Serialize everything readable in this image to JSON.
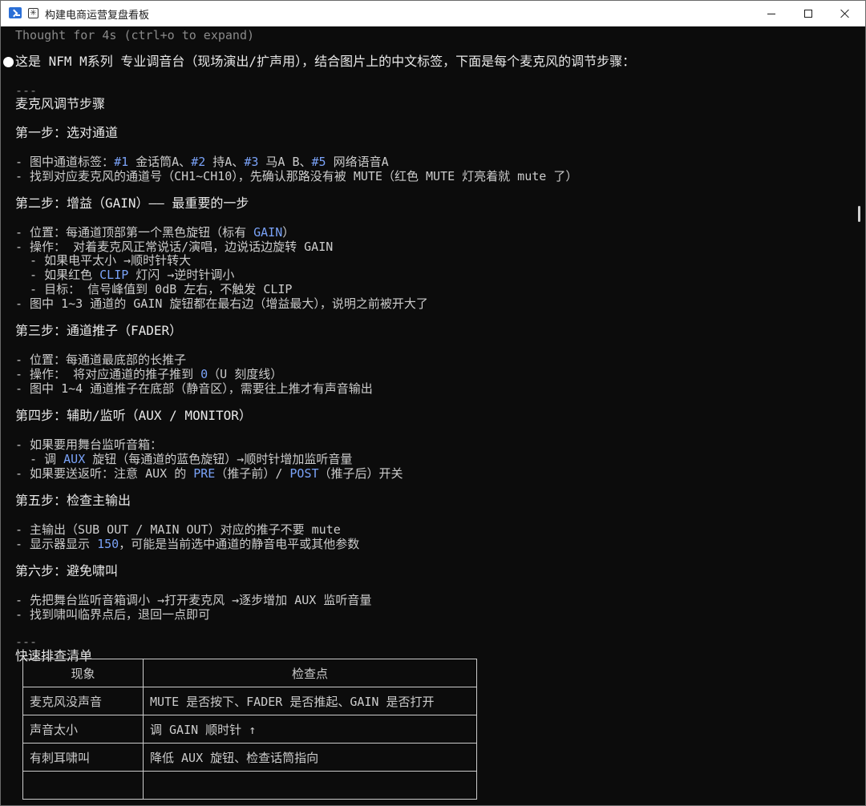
{
  "window": {
    "title": "构建电商运营复盘看板"
  },
  "terminal": {
    "thought": "Thought for 4s (ctrl+o to expand)",
    "intro": "这是 NFM M系列 专业调音台（现场演出/扩声用），结合图片上的中文标签，下面是每个麦克风的调节步骤：",
    "rule1": "---",
    "section_title": "麦克风调节步骤",
    "step1_title": "第一步：选对通道",
    "step1_l1_a": "- 图中通道标签：",
    "step1_l1_h1": "#1",
    "step1_l1_b": " 金话筒A、",
    "step1_l1_h2": "#2",
    "step1_l1_c": " 持A、",
    "step1_l1_h3": "#3",
    "step1_l1_d": " 马A B、",
    "step1_l1_h4": "#5",
    "step1_l1_e": " 网络语音A",
    "step1_l2": "- 找到对应麦克风的通道号（CH1~CH10），先确认那路没有被 MUTE（红色 MUTE 灯亮着就 mute 了）",
    "step2_title": "第二步：增益（GAIN）—— 最重要的一步",
    "step2_l1_a": "- 位置：每通道顶部第一个黑色旋钮（标有 ",
    "step2_l1_h": "GAIN",
    "step2_l1_b": "）",
    "step2_l2": "- 操作： 对着麦克风正常说话/演唱，边说话边旋转 GAIN",
    "step2_l3": "  - 如果电平太小 →顺时针转大",
    "step2_l4_a": "  - 如果红色 ",
    "step2_l4_h": "CLIP",
    "step2_l4_b": " 灯闪 →逆时针调小",
    "step2_l5": "  - 目标： 信号峰值到 0dB 左右，不触发 CLIP",
    "step2_l6": "- 图中 1~3 通道的 GAIN 旋钮都在最右边（增益最大），说明之前被开大了",
    "step3_title": "第三步：通道推子（FADER）",
    "step3_l1": "- 位置：每通道最底部的长推子",
    "step3_l2_a": "- 操作： 将对应通道的推子推到 ",
    "step3_l2_h": "0",
    "step3_l2_b": "（U 刻度线）",
    "step3_l3": "- 图中 1~4 通道推子在底部（静音区），需要往上推才有声音输出",
    "step4_title": "第四步：辅助/监听（AUX / MONITOR）",
    "step4_l1": "- 如果要用舞台监听音箱：",
    "step4_l2_a": "  - 调 ",
    "step4_l2_h": "AUX",
    "step4_l2_b": " 旋钮（每通道的蓝色旋钮）→顺时针增加监听音量",
    "step4_l3_a": "- 如果要送返听：注意 AUX 的 ",
    "step4_l3_h1": "PRE",
    "step4_l3_b": "（推子前）/ ",
    "step4_l3_h2": "POST",
    "step4_l3_c": "（推子后）开关",
    "step5_title": "第五步：检查主输出",
    "step5_l1": "- 主输出（SUB OUT / MAIN OUT）对应的推子不要 mute",
    "step5_l2_a": "- 显示器显示 ",
    "step5_l2_h": "150",
    "step5_l2_b": "，可能是当前选中通道的静音电平或其他参数",
    "step6_title": "第六步：避免啸叫",
    "step6_l1": "- 先把舞台监听音箱调小 →打开麦克风 →逐步增加 AUX 监听音量",
    "step6_l2": "- 找到啸叫临界点后，退回一点即可",
    "rule2": "---",
    "checklist_title": "快速排查清单"
  },
  "checklist": {
    "headers": [
      "现象",
      "检查点"
    ],
    "rows": [
      [
        "麦克风没声音",
        "MUTE 是否按下、FADER 是否推起、GAIN 是否打开"
      ],
      [
        "声音太小",
        "调 GAIN 顺时针 ↑"
      ],
      [
        "有刺耳啸叫",
        "降低 AUX 旋钮、检查话筒指向"
      ]
    ]
  }
}
